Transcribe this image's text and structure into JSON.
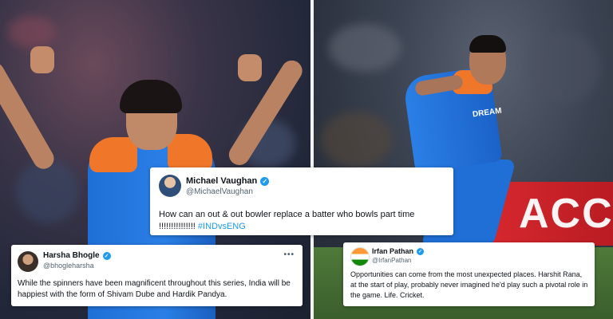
{
  "tweets": [
    {
      "name": "Michael Vaughan",
      "handle": "@MichaelVaughan",
      "text": "How can an out & out bowler replace a batter who bowls part time !!!!!!!!!!!!!!! ",
      "hashtag": "#INDvsENG"
    },
    {
      "name": "Harsha Bhogle",
      "handle": "@bhogleharsha",
      "more": "•••",
      "text": "While the spinners have been magnificent throughout this series, India will be happiest with the form of Shivam Dube and Hardik Pandya."
    },
    {
      "name": "Irfan Pathan",
      "handle": "@IrfanPathan",
      "text": "Opportunities can come from the most unexpected places. Harshit Rana, at the start of play, probably never imagined he'd play such a pivotal role in the game. Life. Cricket."
    }
  ],
  "background": {
    "banner_text": "ACC",
    "jersey_text": "DREAM"
  },
  "colors": {
    "verified": "#1d9bf0",
    "hashtag": "#1d9bf0",
    "jersey_blue": "#1f6fd6",
    "jersey_orange": "#f0762a"
  },
  "icons": {
    "verified": "verified-badge-icon",
    "more": "more-options-icon"
  }
}
